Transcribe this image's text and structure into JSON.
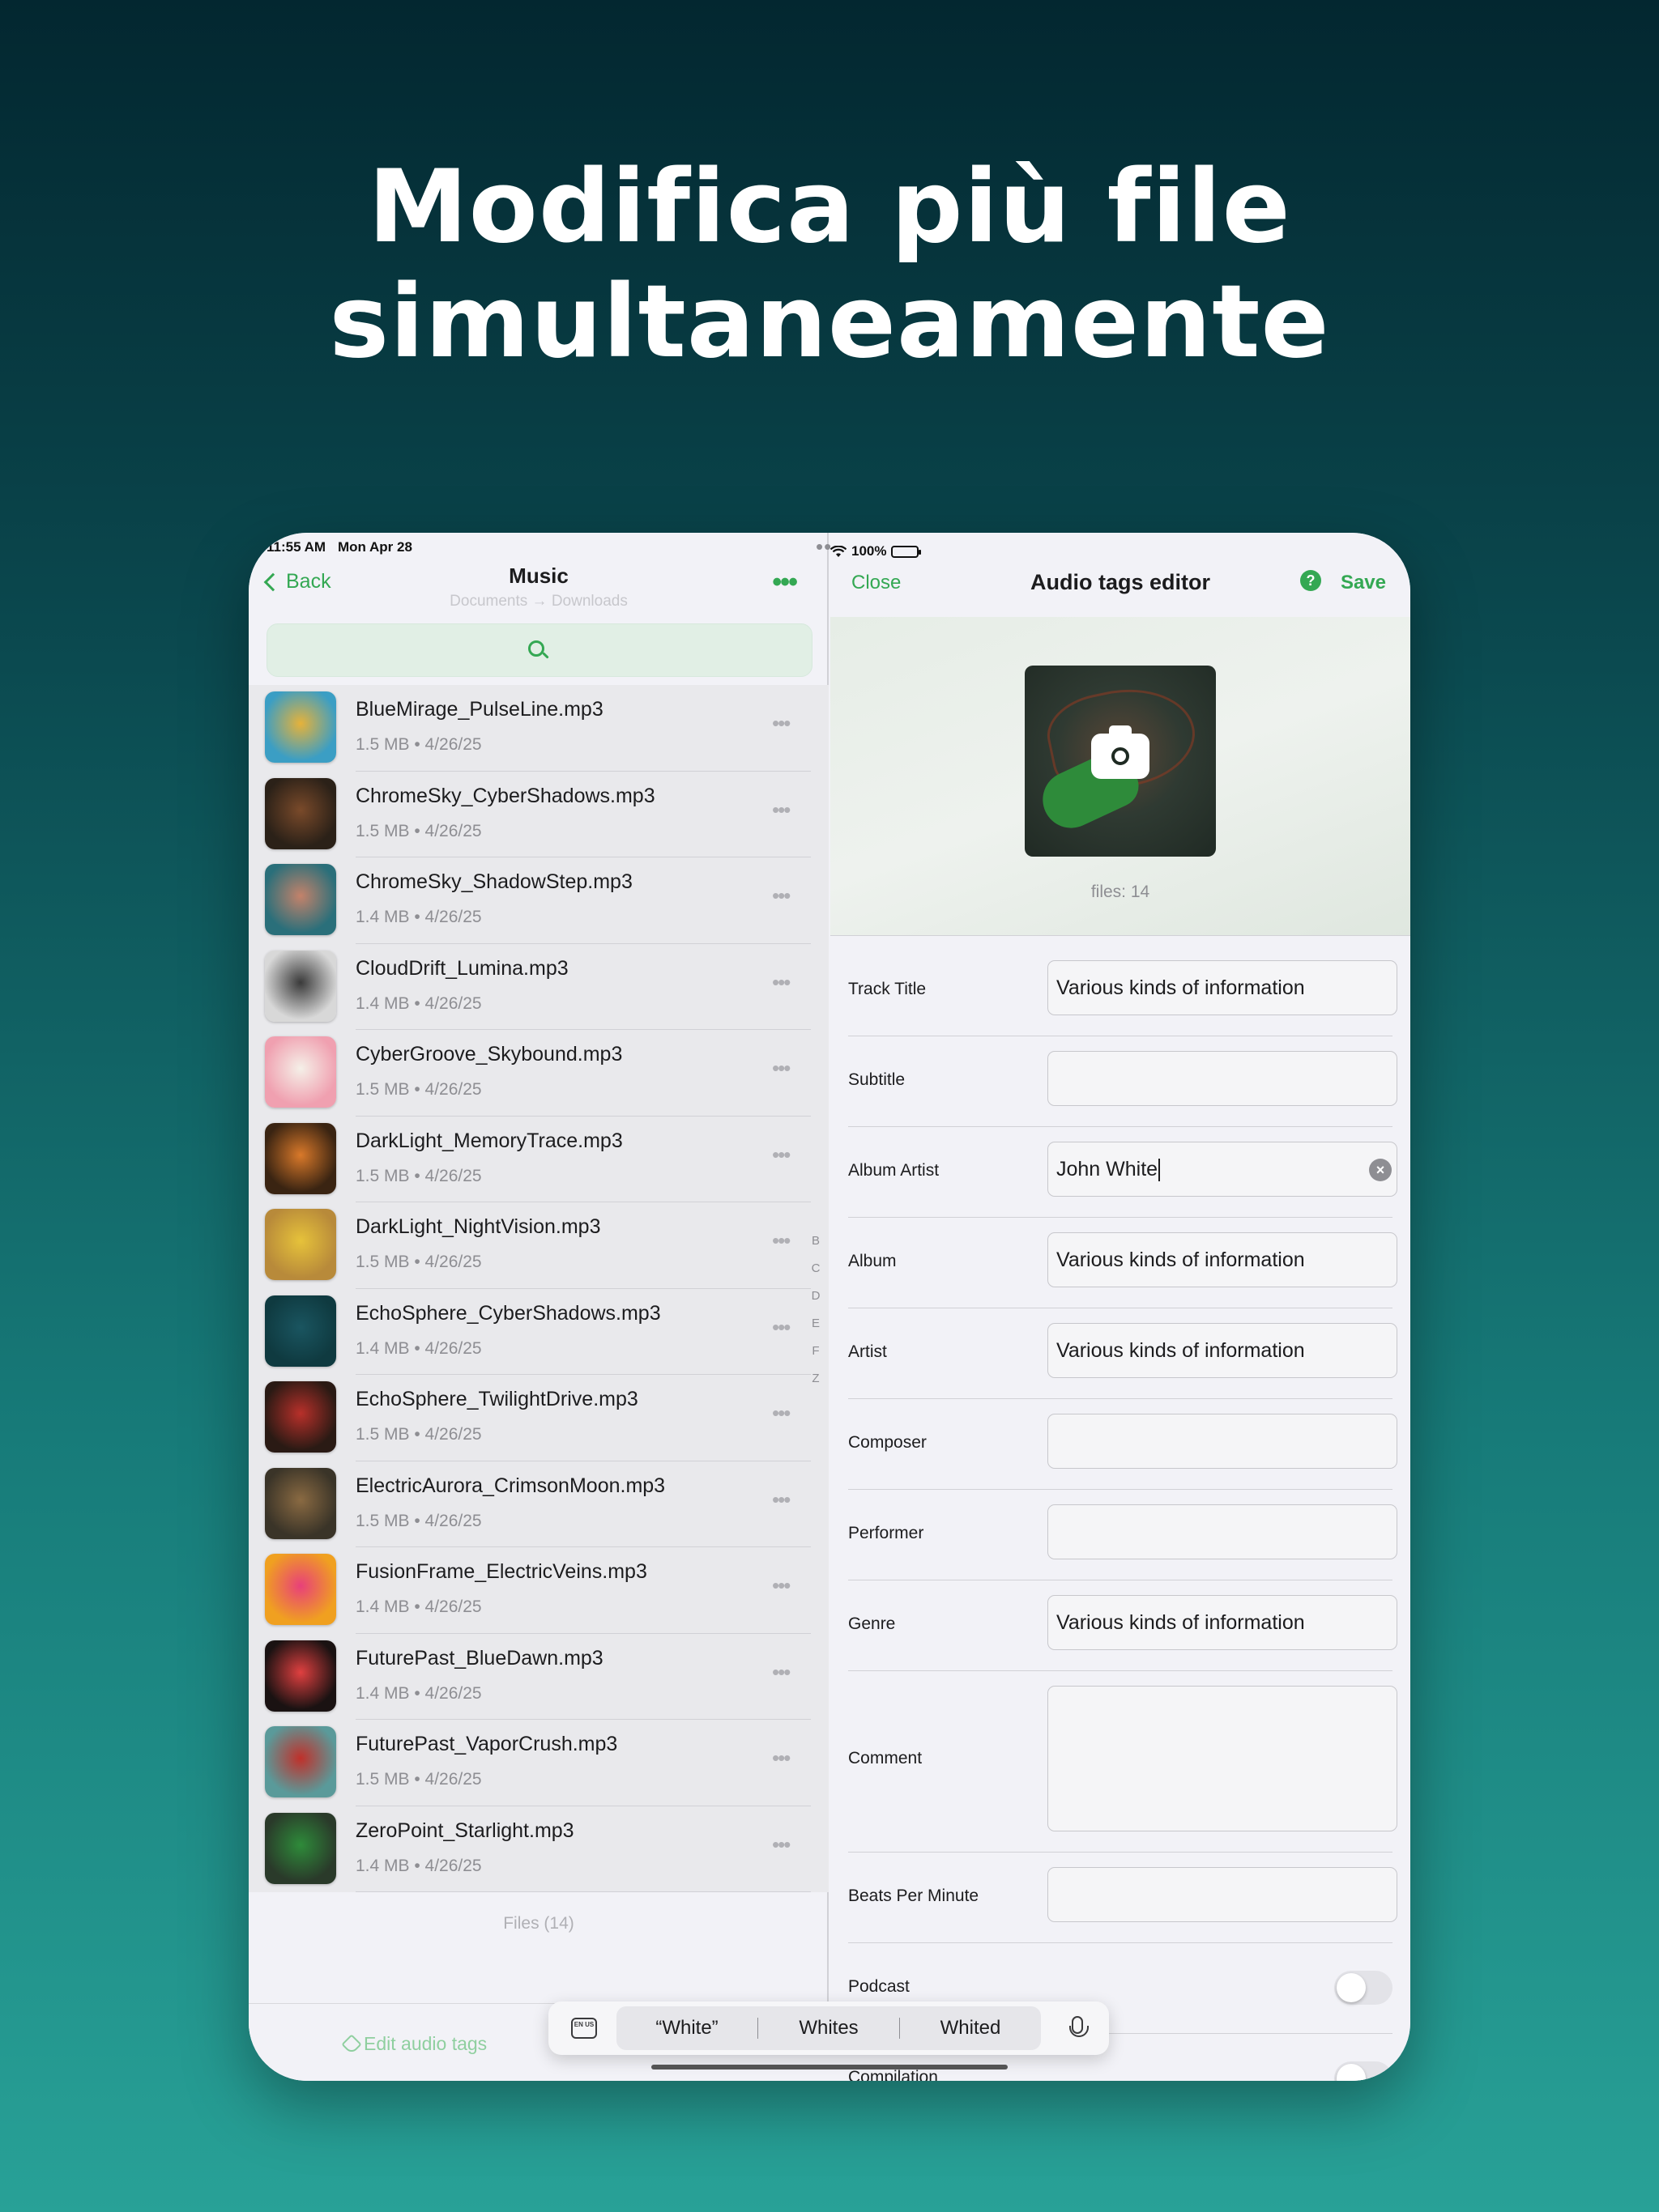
{
  "headline": {
    "line1": "Modifica più file",
    "line2": "simultaneamente"
  },
  "status_bar": {
    "time": "11:55 AM",
    "date": "Mon Apr 28",
    "battery": "100%"
  },
  "left_pane": {
    "back_label": "Back",
    "title": "Music",
    "subtitle": "Documents → Downloads",
    "more_icon": "ellipsis-icon",
    "search_icon": "search-icon",
    "files": [
      {
        "name": "BlueMirage_PulseLine.mp3",
        "meta": "1.5 MB • 4/26/25",
        "thumb": [
          "#3b9ec4",
          "#e6b23a"
        ]
      },
      {
        "name": "ChromeSky_CyberShadows.mp3",
        "meta": "1.5 MB • 4/26/25",
        "thumb": [
          "#2b2118",
          "#7a4a2a"
        ]
      },
      {
        "name": "ChromeSky_ShadowStep.mp3",
        "meta": "1.4 MB • 4/26/25",
        "thumb": [
          "#2a6f7a",
          "#c4826a"
        ]
      },
      {
        "name": "CloudDrift_Lumina.mp3",
        "meta": "1.4 MB • 4/26/25",
        "thumb": [
          "#d8d8d8",
          "#3a3a3a"
        ]
      },
      {
        "name": "CyberGroove_Skybound.mp3",
        "meta": "1.5 MB • 4/26/25",
        "thumb": [
          "#f0a0b0",
          "#f5f0e8"
        ]
      },
      {
        "name": "DarkLight_MemoryTrace.mp3",
        "meta": "1.5 MB • 4/26/25",
        "thumb": [
          "#3a2412",
          "#d9792a"
        ]
      },
      {
        "name": "DarkLight_NightVision.mp3",
        "meta": "1.5 MB • 4/26/25",
        "thumb": [
          "#b88a3a",
          "#e6c23a"
        ]
      },
      {
        "name": "EchoSphere_CyberShadows.mp3",
        "meta": "1.4 MB • 4/26/25",
        "thumb": [
          "#0f3a40",
          "#1a5560"
        ]
      },
      {
        "name": "EchoSphere_TwilightDrive.mp3",
        "meta": "1.5 MB • 4/26/25",
        "thumb": [
          "#2a1a14",
          "#b8302a"
        ]
      },
      {
        "name": "ElectricAurora_CrimsonMoon.mp3",
        "meta": "1.5 MB • 4/26/25",
        "thumb": [
          "#3a3428",
          "#8a6a42"
        ]
      },
      {
        "name": "FusionFrame_ElectricVeins.mp3",
        "meta": "1.4 MB • 4/26/25",
        "thumb": [
          "#f0a020",
          "#e8407a"
        ]
      },
      {
        "name": "FuturePast_BlueDawn.mp3",
        "meta": "1.4 MB • 4/26/25",
        "thumb": [
          "#1a1212",
          "#e04040"
        ]
      },
      {
        "name": "FuturePast_VaporCrush.mp3",
        "meta": "1.5 MB • 4/26/25",
        "thumb": [
          "#5a9a9a",
          "#c0302a"
        ]
      },
      {
        "name": "ZeroPoint_Starlight.mp3",
        "meta": "1.4 MB • 4/26/25",
        "thumb": [
          "#2a3a2a",
          "#2e8b3a"
        ]
      }
    ],
    "index_letters": [
      "B",
      "C",
      "D",
      "E",
      "F",
      "Z"
    ],
    "files_count": "Files (14)",
    "edit_tags_label": "Edit audio tags"
  },
  "right_pane": {
    "close_label": "Close",
    "title": "Audio tags editor",
    "help_label": "?",
    "save_label": "Save",
    "files_label": "files: 14",
    "fields": {
      "track_title": {
        "label": "Track Title",
        "value": "Various kinds of information"
      },
      "subtitle": {
        "label": "Subtitle",
        "value": ""
      },
      "album_artist": {
        "label": "Album Artist",
        "value": "John White"
      },
      "album": {
        "label": "Album",
        "value": "Various kinds of information"
      },
      "artist": {
        "label": "Artist",
        "value": "Various kinds of information"
      },
      "composer": {
        "label": "Composer",
        "value": ""
      },
      "performer": {
        "label": "Performer",
        "value": ""
      },
      "genre": {
        "label": "Genre",
        "value": "Various kinds of information"
      },
      "comment": {
        "label": "Comment",
        "value": ""
      },
      "bpm": {
        "label": "Beats Per Minute",
        "value": ""
      },
      "podcast": {
        "label": "Podcast",
        "on": false
      },
      "compilation": {
        "label": "Compilation",
        "on": false
      }
    }
  },
  "keyboard": {
    "lang": "EN US",
    "suggestions": [
      "“White”",
      "Whites",
      "Whited"
    ]
  },
  "colors": {
    "accent": "#34a853",
    "bg_top": "#032730",
    "bg_bottom": "#28a197"
  }
}
